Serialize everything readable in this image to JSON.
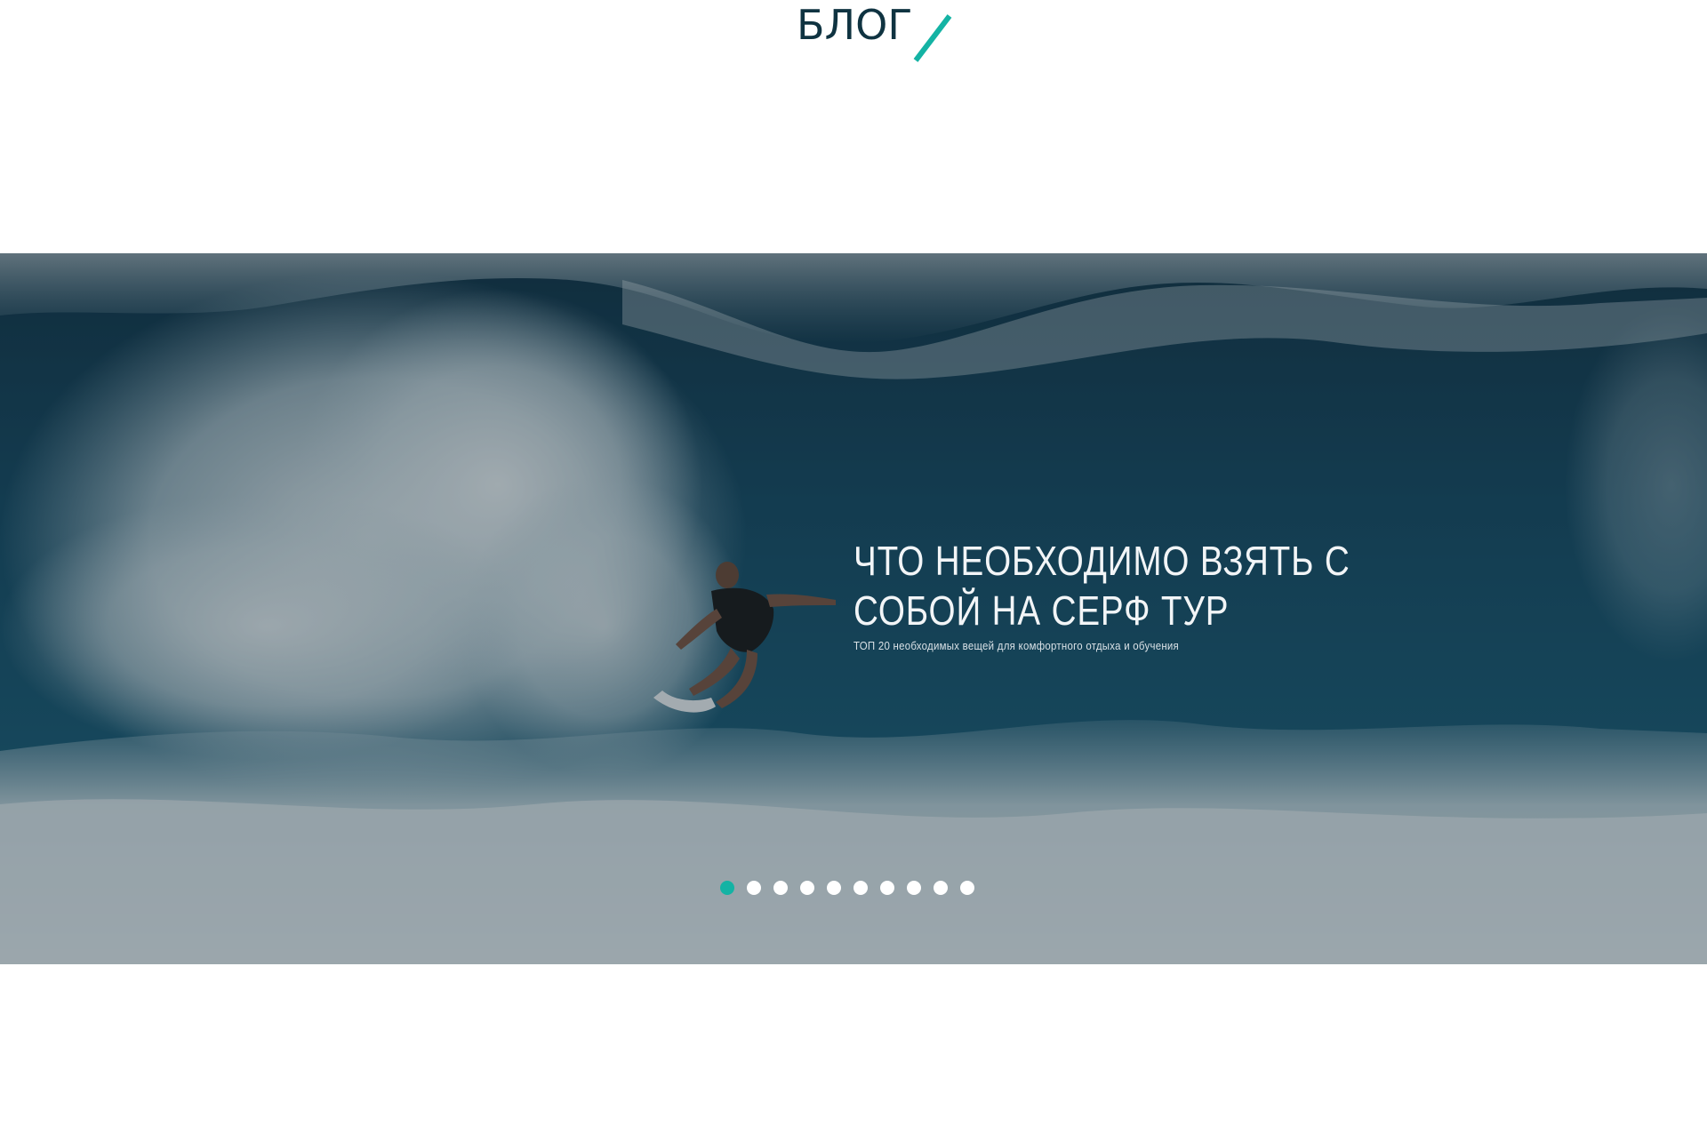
{
  "header": {
    "title": "БЛОГ",
    "accent_color": "#14b3a4",
    "title_color": "#0f3341"
  },
  "slider": {
    "slide": {
      "title": "ЧТО НЕОБХОДИМО ВЗЯТЬ С СОБОЙ НА СЕРФ ТУР",
      "subtitle": "ТОП 20 необходимых вещей для комфортного отдыха и обучения"
    },
    "dots_total": 10,
    "active_dot": 1,
    "active_color": "#14b3a4"
  }
}
